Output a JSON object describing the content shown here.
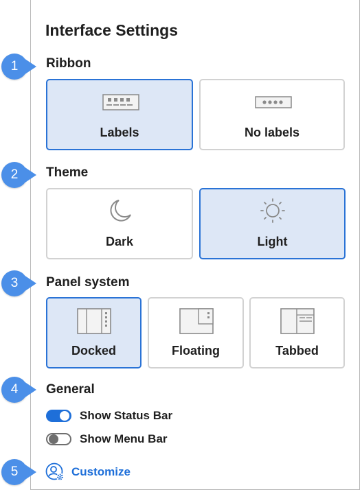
{
  "panel": {
    "title": "Interface Settings"
  },
  "callouts": [
    "1",
    "2",
    "3",
    "4",
    "5"
  ],
  "sections": {
    "ribbon": {
      "label": "Ribbon",
      "options": [
        {
          "label": "Labels",
          "icon": "ribbon-labels-icon",
          "selected": true
        },
        {
          "label": "No labels",
          "icon": "ribbon-no-labels-icon",
          "selected": false
        }
      ]
    },
    "theme": {
      "label": "Theme",
      "options": [
        {
          "label": "Dark",
          "icon": "moon-icon",
          "selected": false
        },
        {
          "label": "Light",
          "icon": "sun-icon",
          "selected": true
        }
      ]
    },
    "panel_system": {
      "label": "Panel system",
      "options": [
        {
          "label": "Docked",
          "icon": "docked-panel-icon",
          "selected": true
        },
        {
          "label": "Floating",
          "icon": "floating-panel-icon",
          "selected": false
        },
        {
          "label": "Tabbed",
          "icon": "tabbed-panel-icon",
          "selected": false
        }
      ]
    },
    "general": {
      "label": "General",
      "toggles": [
        {
          "label": "Show Status Bar",
          "on": true
        },
        {
          "label": "Show Menu Bar",
          "on": false
        }
      ]
    }
  },
  "customize": {
    "label": "Customize",
    "icon": "user-gear-icon"
  },
  "colors": {
    "accent": "#1e6fd9",
    "callout": "#4b8fe8",
    "selected_bg": "#dde7f6",
    "card_border": "#d2d2d2"
  }
}
